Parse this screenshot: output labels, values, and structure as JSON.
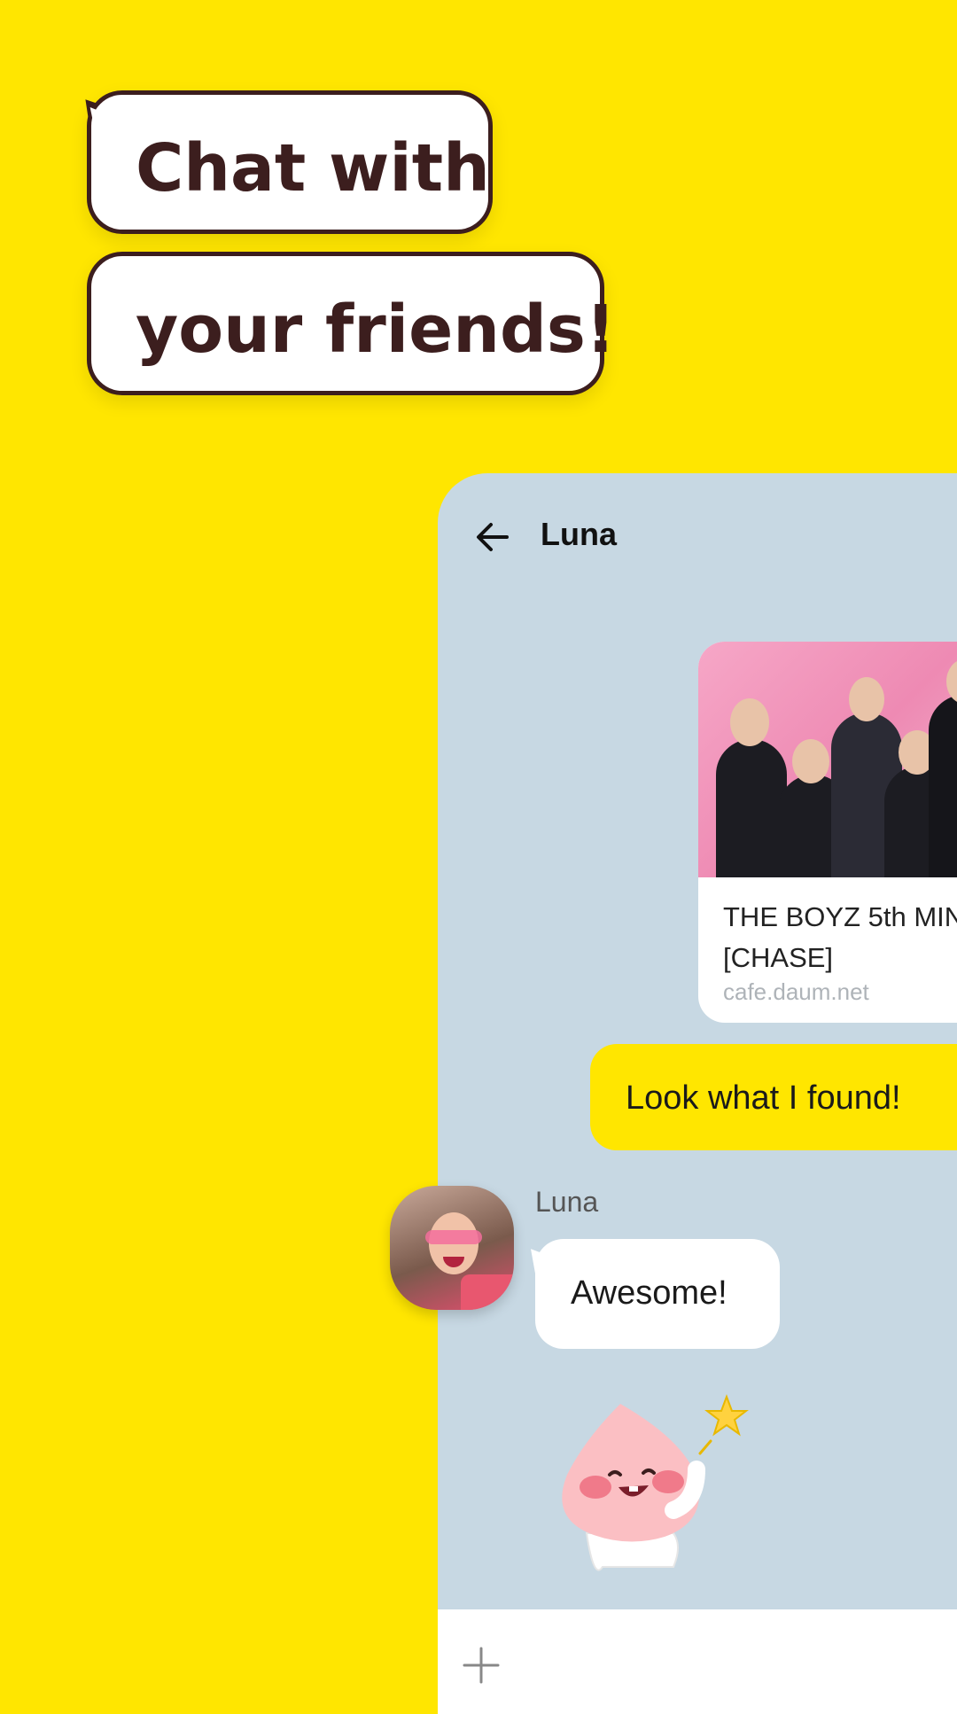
{
  "headline": {
    "line1": "Chat with",
    "line2": "your friends!"
  },
  "colors": {
    "background": "#FFE600",
    "chat_background": "#C7D8E3",
    "headline_text": "#3C1E1E",
    "sent_bubble": "#FFE600",
    "received_bubble": "#FFFFFF"
  },
  "chat": {
    "title": "Luna",
    "back_icon": "arrow-left-icon",
    "link_card": {
      "title_line1": "THE BOYZ 5th MIN",
      "title_line2": "[CHASE]",
      "domain": "cafe.daum.net"
    },
    "sent_message": "Look what I found!",
    "received": {
      "sender": "Luna",
      "message": "Awesome!"
    },
    "sticker": "peach-character-sticker",
    "input": {
      "plus_icon": "plus-icon"
    }
  }
}
